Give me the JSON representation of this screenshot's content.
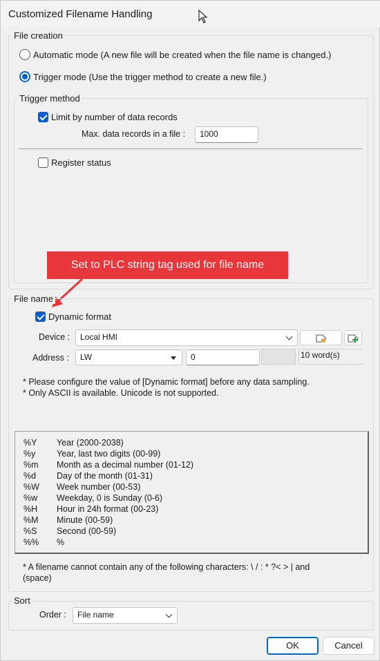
{
  "window": {
    "title": "Customized Filename Handling"
  },
  "file_creation": {
    "label": "File creation",
    "auto_mode": "Automatic mode (A new file will be created when the file name is changed.)",
    "trigger_mode": "Trigger mode (Use the trigger method to create a new file.)",
    "selected": "trigger"
  },
  "trigger_method": {
    "label": "Trigger method",
    "limit_label": "Limit by number of data records",
    "limit_checked": true,
    "max_records_label": "Max. data records in a file :",
    "max_records_value": "1000",
    "register_status_label": "Register status",
    "register_status_checked": false
  },
  "callout": {
    "text": "Set to PLC string tag used for file name",
    "color": "#e8373a"
  },
  "file_name": {
    "label": "File name",
    "dynamic_label": "Dynamic format",
    "dynamic_checked": true,
    "device_label": "Device :",
    "device_value": "Local HMI",
    "address_label": "Address :",
    "address_type": "LW",
    "address_value": "0",
    "word_count": "10 word(s)",
    "note1": "* Please configure the value of [Dynamic format] before any data sampling.",
    "note2": "* Only ASCII is available. Unicode is not supported.",
    "formats": [
      {
        "key": "%Y",
        "desc": "Year (2000-2038)"
      },
      {
        "key": "%y",
        "desc": "Year, last two digits (00-99)"
      },
      {
        "key": "%m",
        "desc": "Month as a decimal number (01-12)"
      },
      {
        "key": "%d",
        "desc": "Day of the month (01-31)"
      },
      {
        "key": "%W",
        "desc": "Week number (00-53)"
      },
      {
        "key": "%w",
        "desc": "Weekday, 0 is Sunday (0-6)"
      },
      {
        "key": "%H",
        "desc": "Hour in 24h format (00-23)"
      },
      {
        "key": "%M",
        "desc": "Minute (00-59)"
      },
      {
        "key": "%S",
        "desc": "Second (00-59)"
      },
      {
        "key": "%%",
        "desc": "%"
      }
    ],
    "char_note_line1": "* A filename cannot contain any of the following characters:  \\ / : * ?< > | and",
    "char_note_line2": "(space)"
  },
  "sort": {
    "label": "Sort",
    "order_label": "Order :",
    "order_value": "File name"
  },
  "buttons": {
    "ok": "OK",
    "cancel": "Cancel"
  },
  "colors": {
    "accent": "#0a5ec9",
    "callout": "#e8373a"
  }
}
